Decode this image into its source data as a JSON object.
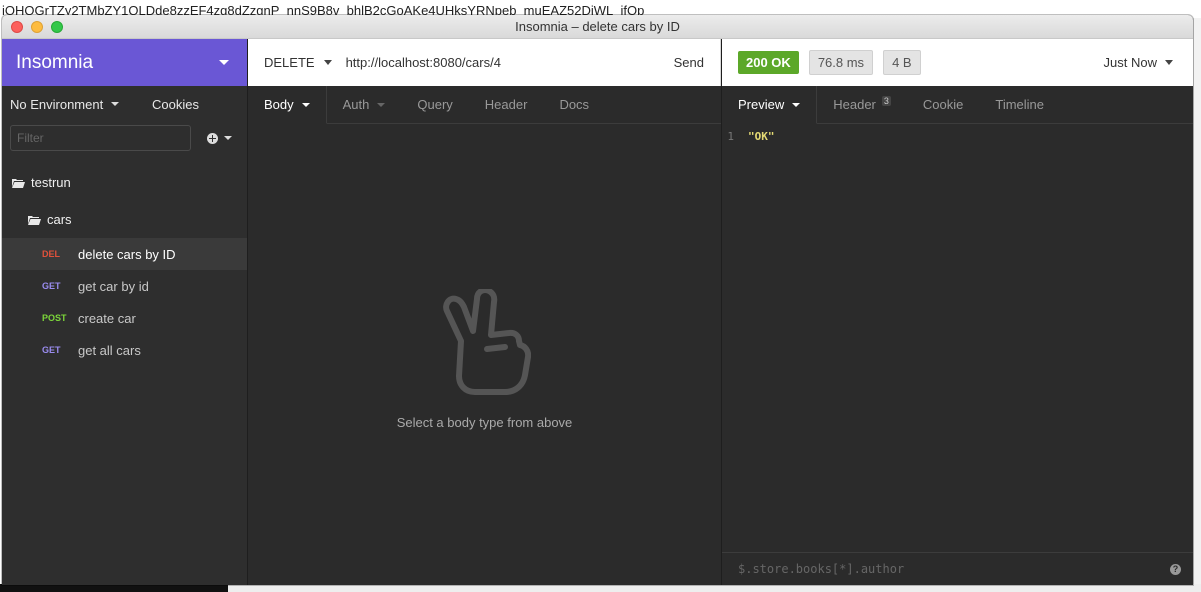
{
  "background": {
    "top_text": "iOHQGrTZy2TMbZY1QLDde8zzEF4zg8dZzgnP_nnS9B8v_bhlB2cGoAKe4UHksYRNpeb_muEAZ52DiWL_ifOp"
  },
  "window": {
    "title": "Insomnia – delete cars by ID"
  },
  "sidebar": {
    "brand": "Insomnia",
    "environment": "No Environment",
    "cookies": "Cookies",
    "filter_placeholder": "Filter",
    "workspace": "testrun",
    "folder": "cars",
    "requests": [
      {
        "method": "DEL",
        "name": "delete cars by ID"
      },
      {
        "method": "GET",
        "name": "get car by id"
      },
      {
        "method": "POST",
        "name": "create car"
      },
      {
        "method": "GET",
        "name": "get all cars"
      }
    ]
  },
  "request": {
    "method": "DELETE",
    "url": "http://localhost:8080/cars/4",
    "send_label": "Send",
    "tabs": [
      "Body",
      "Auth",
      "Query",
      "Header",
      "Docs"
    ],
    "empty_message": "Select a body type from above"
  },
  "response": {
    "status": "200 OK",
    "time": "76.8 ms",
    "size": "4 B",
    "when": "Just Now",
    "tabs": {
      "preview": "Preview",
      "header": "Header",
      "header_count": "3",
      "cookie": "Cookie",
      "timeline": "Timeline"
    },
    "body_line_number": "1",
    "body_value": "\"OK\"",
    "filter_placeholder": "$.store.books[*].author",
    "help": "?"
  },
  "colors": {
    "brand": "#6a57d5",
    "status_ok": "#5ca829",
    "method_del": "#e0513b",
    "method_get": "#9a8cf0",
    "method_post": "#7cd63a"
  }
}
